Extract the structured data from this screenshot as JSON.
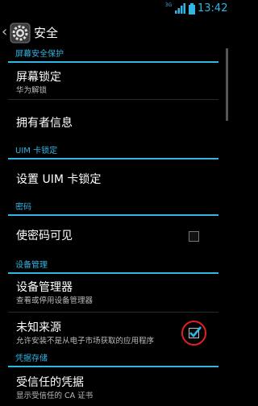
{
  "status_bar": {
    "network": "3G",
    "time": "13:42"
  },
  "action_bar": {
    "title": "安全"
  },
  "sections": {
    "screen": "屏幕安全保护",
    "uim": "UIM 卡锁定",
    "password": "密码",
    "device_admin": "设备管理",
    "credentials": "凭据存储"
  },
  "items": {
    "screen_lock": {
      "title": "屏幕锁定",
      "summary": "华为解锁"
    },
    "owner_info": {
      "title": "拥有者信息"
    },
    "uim_lock": {
      "title": "设置 UIM 卡锁定"
    },
    "show_password": {
      "title": "使密码可见",
      "checked": false
    },
    "device_admins": {
      "title": "设备管理器",
      "summary": "查看或停用设备管理器"
    },
    "unknown_sources": {
      "title": "未知来源",
      "summary": "允许安装不是从电子市场获取的应用程序",
      "checked": true
    },
    "trusted_credentials": {
      "title": "受信任的凭据",
      "summary": "显示受信任的 CA 证书"
    }
  },
  "colors": {
    "accent": "#33b5e5",
    "highlight": "#e02020",
    "background": "#000000"
  }
}
